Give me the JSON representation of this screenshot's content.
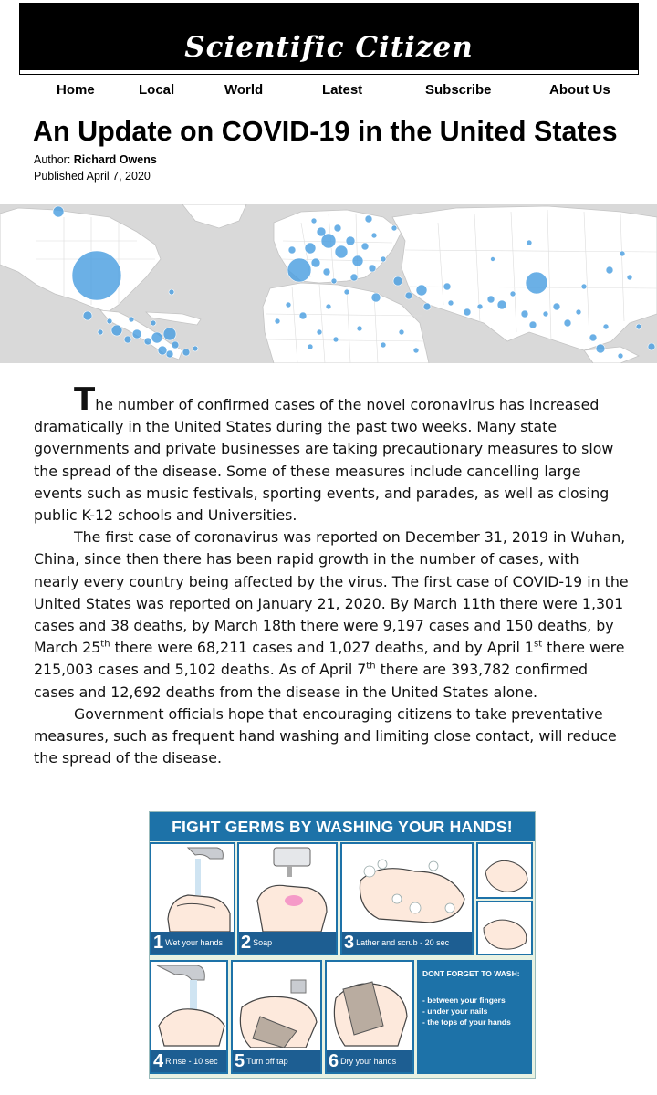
{
  "site": {
    "name": "Scientific Citizen"
  },
  "nav": {
    "items": [
      "Home",
      "Local",
      "World",
      "Latest",
      "Subscribe",
      "About Us"
    ]
  },
  "article": {
    "title": "An Update on COVID-19 in the United States",
    "author_label": "Author: ",
    "author": "Richard Owens",
    "published": "Published April 7, 2020",
    "p1_dropcap": "T",
    "p1_rest": "he number of confirmed cases of the novel coronavirus has increased dramatically in the United States during the past two weeks. Many state governments and private businesses are taking precautionary measures to slow the spread of the disease. Some of these measures include cancelling large events such as music festivals, sporting events, and parades, as well as closing public K-12 schools and Universities.",
    "p2_a": "The first case of coronavirus was reported on December 31, 2019 in Wuhan, China, since then there has been rapid growth in the number of cases, with nearly every country being affected by the virus. The first case of COVID-19 in the United States was reported on January 21, 2020. By March 11th there were 1,301 cases and 38 deaths, by March 18th there were 9,197 cases and 150 deaths, by March 25",
    "p2_sup1": "th",
    "p2_b": " there were 68,211 cases and 1,027 deaths, and by April 1",
    "p2_sup2": "st",
    "p2_c": " there were 215,003 cases and 5,102 deaths. As of April 7",
    "p2_sup3": "th",
    "p2_d": " there are 393,782 confirmed cases and 12,692 deaths from the disease in the United States alone.",
    "p3": "Government officials hope that encouraging citizens to take preventative measures, such as frequent hand washing and limiting close contact, will reduce the spread of the disease."
  },
  "poster": {
    "title": "FIGHT GERMS BY WASHING YOUR HANDS!",
    "steps": [
      {
        "num": "1",
        "label": "Wet your hands"
      },
      {
        "num": "2",
        "label": "Soap"
      },
      {
        "num": "3",
        "label": "Lather and scrub - 20 sec"
      },
      {
        "num": "4",
        "label": "Rinse - 10 sec"
      },
      {
        "num": "5",
        "label": "Turn off tap"
      },
      {
        "num": "6",
        "label": "Dry your hands"
      }
    ],
    "note_title": "DONT FORGET TO WASH:",
    "note_items": [
      "- between your fingers",
      "- under your nails",
      "- the tops of your hands"
    ]
  },
  "colors": {
    "masthead": "#000000",
    "map_bubble": "#4a9fe0",
    "poster_blue": "#1d72a8"
  }
}
